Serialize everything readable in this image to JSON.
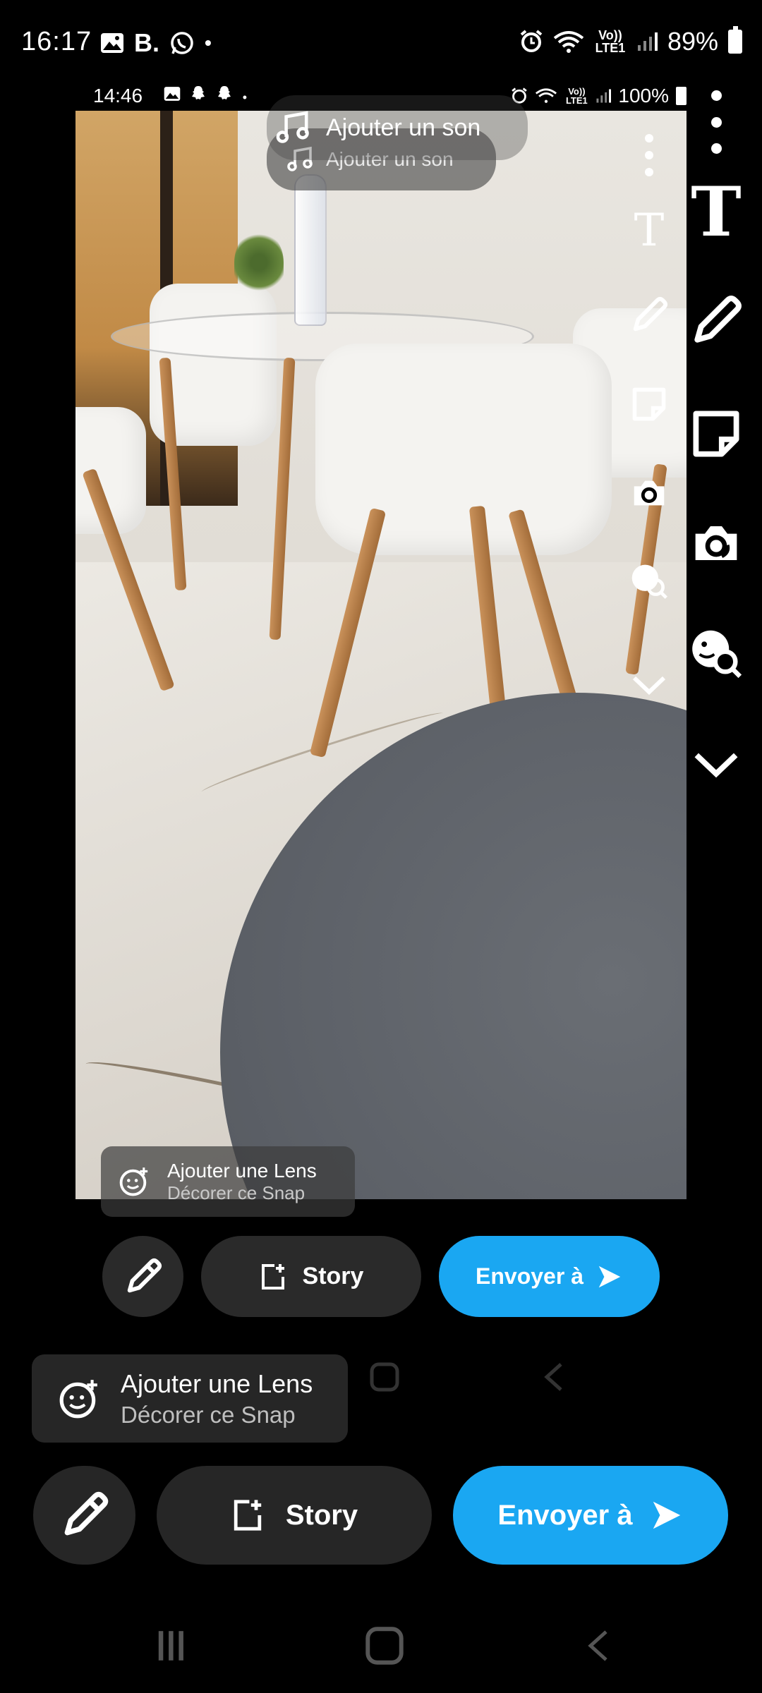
{
  "status_bar": {
    "time": "16:17",
    "left_icons": [
      "gallery-icon",
      "B.",
      "whatsapp-icon",
      "•"
    ],
    "carrier": "Vo)) LTE1",
    "battery": "89%"
  },
  "preview": {
    "status_bar": {
      "time": "14:46",
      "carrier": "Vo)) LTE1",
      "battery": "100%"
    },
    "sound_label": "Ajouter un son",
    "lens": {
      "title": "Ajouter une Lens",
      "subtitle": "Décorer ce Snap"
    },
    "story_label": "Story",
    "send_label": "Envoyer à"
  },
  "sound": {
    "label": "Ajouter un son"
  },
  "tools": [
    "text-tool",
    "draw-tool",
    "sticker-tool",
    "lens-tool",
    "emoji-search-tool",
    "more-tools"
  ],
  "tool_text_glyph": "T",
  "lens": {
    "title": "Ajouter une Lens",
    "subtitle": "Décorer ce Snap"
  },
  "actions": {
    "story_label": "Story",
    "send_label": "Envoyer à"
  },
  "colors": {
    "accent": "#1aa7f2",
    "button_bg": "#262626"
  }
}
